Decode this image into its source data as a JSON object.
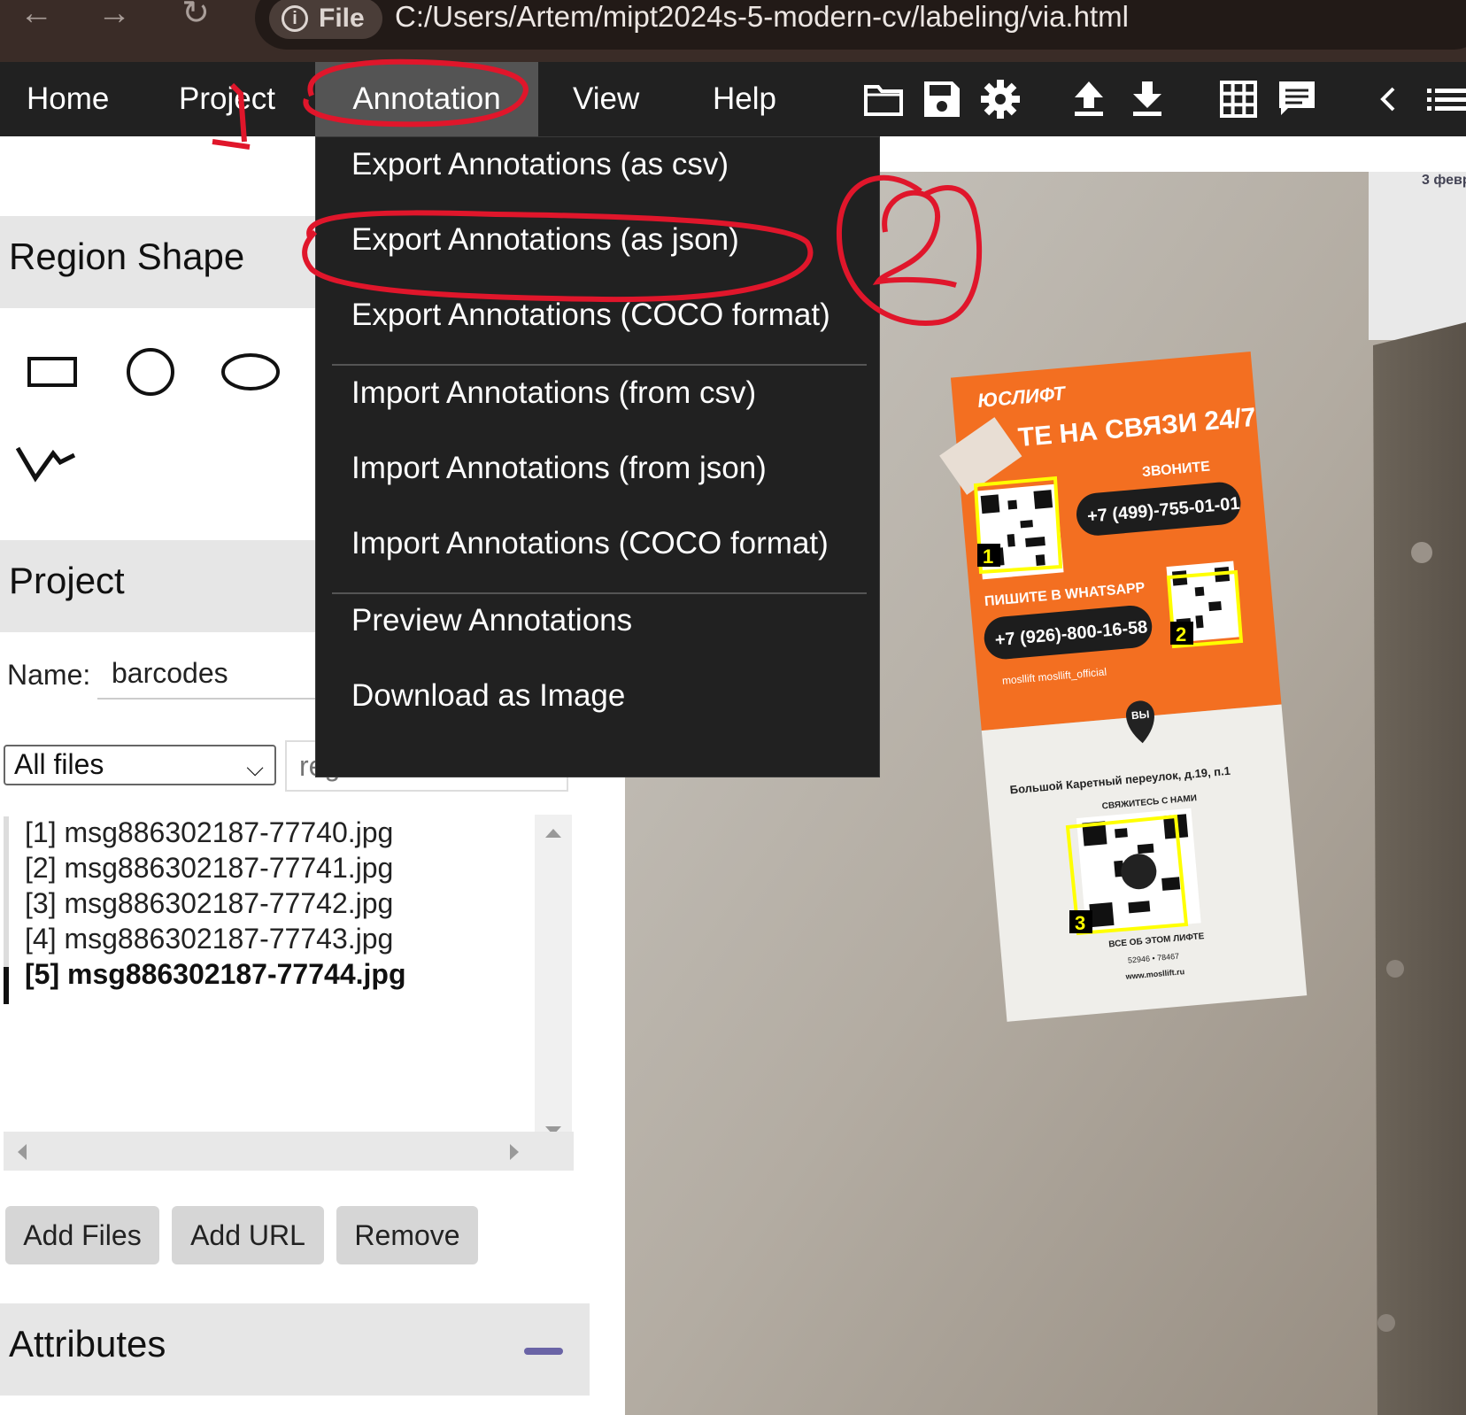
{
  "browser": {
    "file_chip_label": "File",
    "url": "C:/Users/Artem/mipt2024s-5-modern-cv/labeling/via.html"
  },
  "top_menu": {
    "items": [
      "Home",
      "Project",
      "Annotation",
      "View",
      "Help"
    ]
  },
  "annotation_menu": {
    "items": [
      "Export Annotations (as csv)",
      "Export Annotations (as json)",
      "Export Annotations (COCO format)",
      "Import Annotations (from csv)",
      "Import Annotations (from json)",
      "Import Annotations (COCO format)",
      "Preview Annotations",
      "Download as Image"
    ]
  },
  "left_panel": {
    "region_shape_title": "Region Shape",
    "project_title": "Project",
    "name_label": "Name:",
    "name_value": "barcodes",
    "filter_value": "All files",
    "regex_placeholder": "regex",
    "files": [
      "[1] msg886302187-77740.jpg",
      "[2] msg886302187-77741.jpg",
      "[3] msg886302187-77742.jpg",
      "[4] msg886302187-77743.jpg",
      "[5] msg886302187-77744.jpg"
    ],
    "active_file_index": 4,
    "buttons": {
      "add_files": "Add Files",
      "add_url": "Add URL",
      "remove": "Remove"
    },
    "attributes_title": "Attributes"
  },
  "image": {
    "corner_text": "3 февр",
    "sticker_brand": "ЮСЛИФТ",
    "sticker_headline": "ТЕ НА СВЯЗИ 24/7",
    "call_label": "ЗВОНИТЕ",
    "phone_1": "+7 (499)-755-01-01",
    "whatsapp_label": "ПИШИТЕ В WHATSAPP",
    "phone_2": "+7 (926)-800-16-58",
    "social_text": "mosllift   mosllift_official",
    "pin_label": "ВЫ",
    "address": "Большой Каретный переулок, д.19, п.1",
    "contact_label": "СВЯЖИТЕСЬ С НАМИ",
    "footer_line1": "ВСЕ ОБ ЭТОМ ЛИФТЕ",
    "footer_line2": "52946 • 78467",
    "footer_line3": "www.mosllift.ru",
    "region_labels": [
      "1",
      "2",
      "3"
    ]
  },
  "markup": {
    "step_1": "1",
    "step_2": "2"
  },
  "colors": {
    "menu_bg": "#212121",
    "menu_active": "#545454",
    "annotation_red": "#e0162b",
    "region_yellow": "#ffff00",
    "sticker_orange": "#f36f21"
  }
}
